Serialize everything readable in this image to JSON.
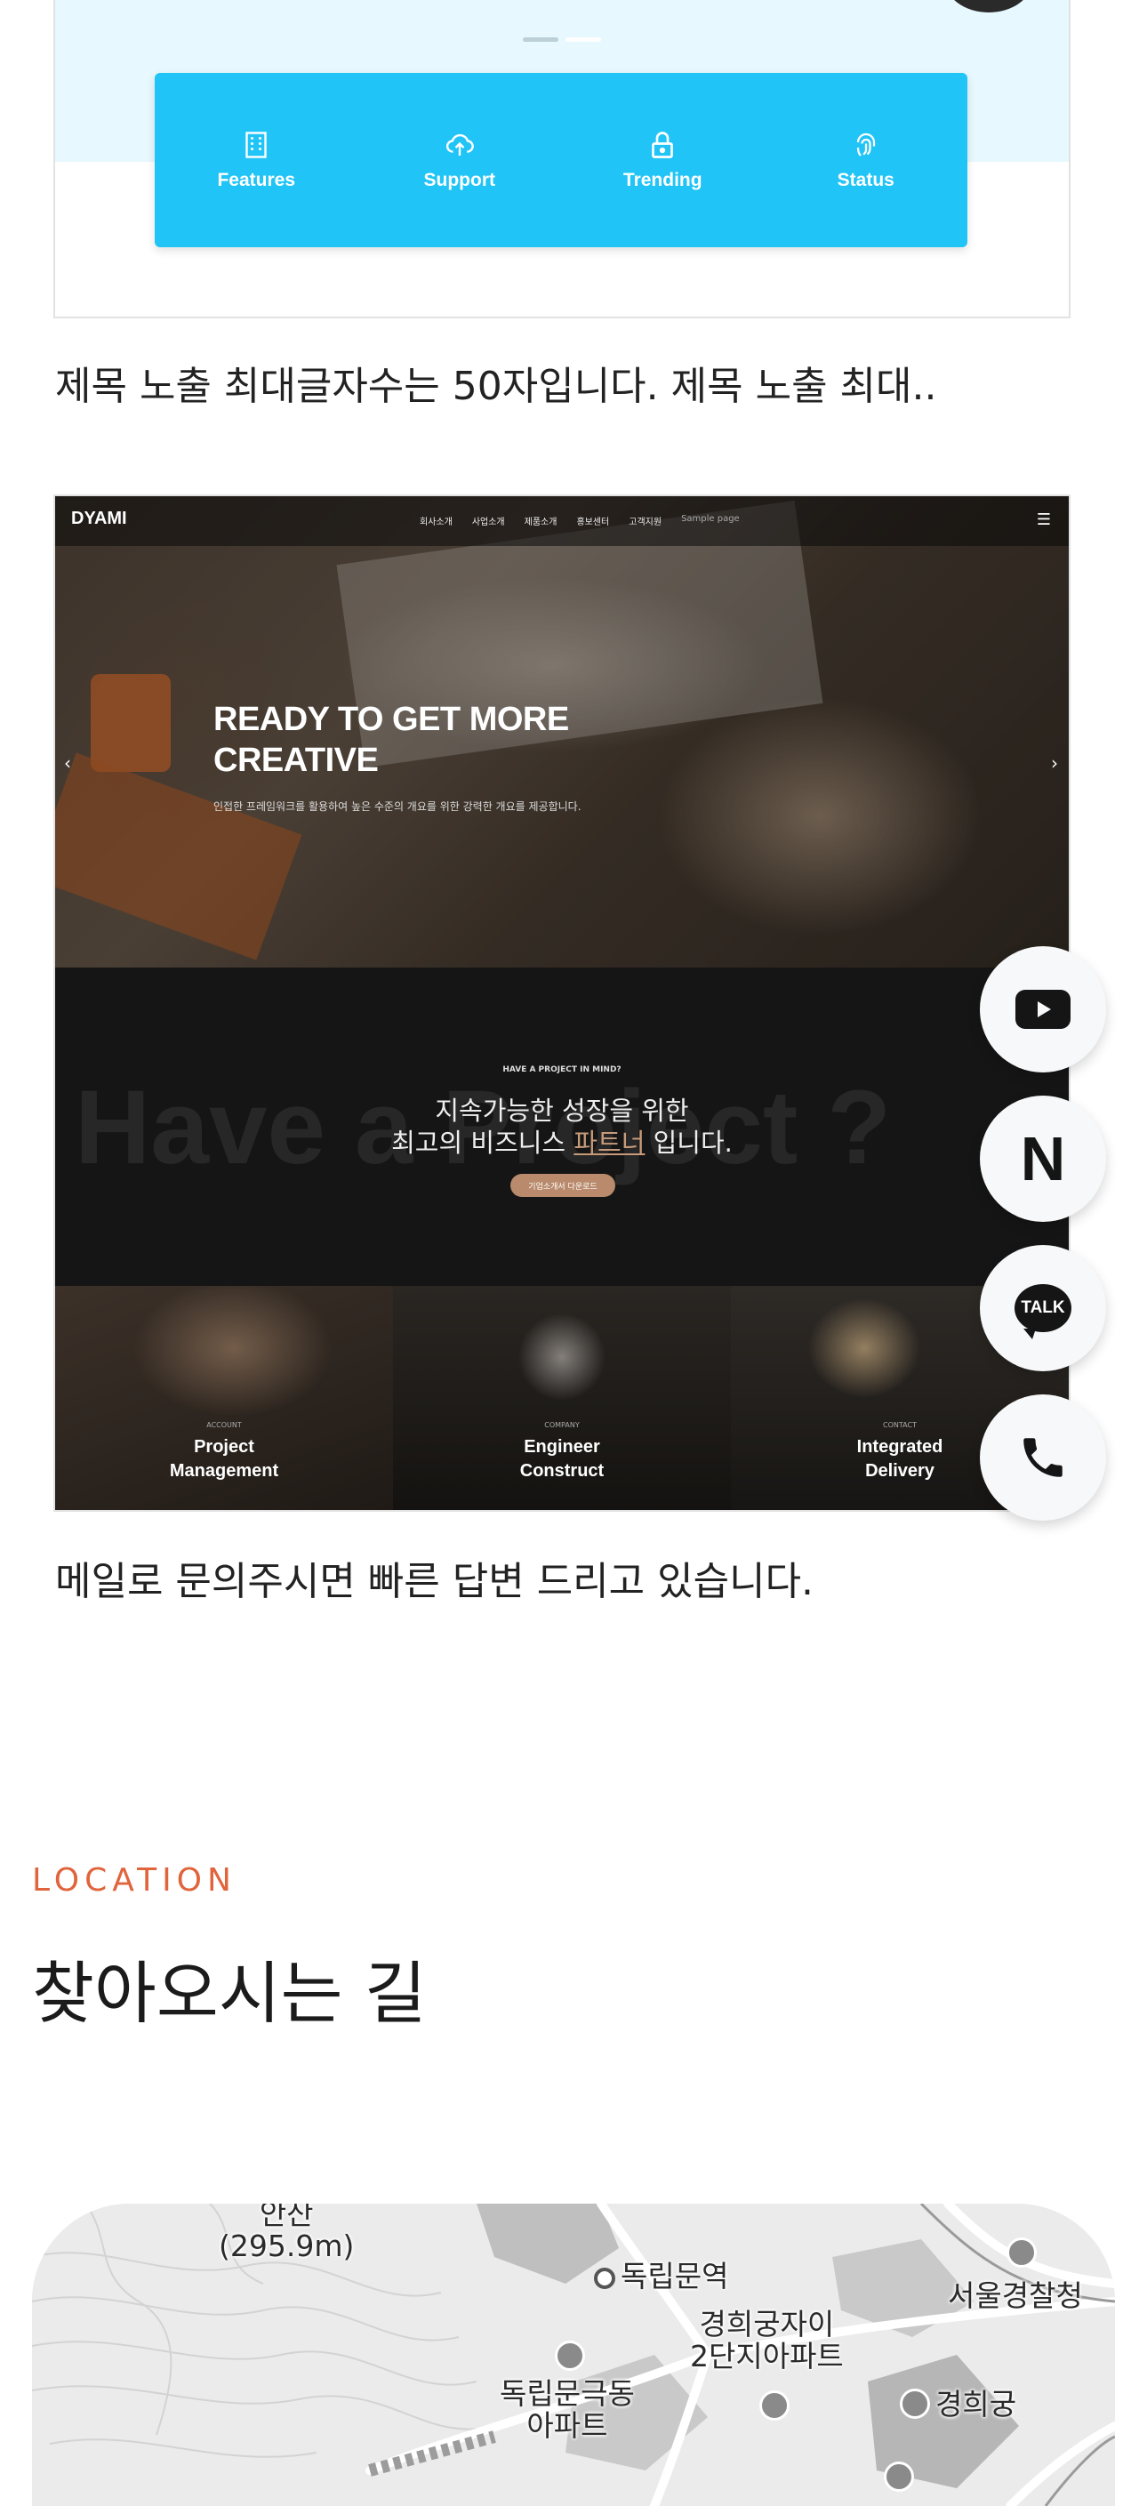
{
  "portfolio_item_1": {
    "feature_bar": {
      "items": [
        {
          "label": "Features",
          "icon": "building-icon"
        },
        {
          "label": "Support",
          "icon": "cloud-upload-icon"
        },
        {
          "label": "Trending",
          "icon": "lock-icon"
        },
        {
          "label": "Status",
          "icon": "fingerprint-icon"
        }
      ],
      "color": "#20c4f6"
    },
    "caption": "제목 노출 최대글자수는 50자입니다. 제목 노출 최대.."
  },
  "portfolio_item_2": {
    "preview": {
      "logo": "DYAMI",
      "menu": [
        "회사소개",
        "사업소개",
        "제품소개",
        "홍보센터",
        "고객지원",
        "Sample page"
      ],
      "hero_title_line1": "READY TO GET MORE",
      "hero_title_line2": "CREATIVE",
      "hero_sub": "인접한 프레임워크를 활용하여 높은 수준의 개요를 위한 강력한 개요를 제공합니다.",
      "mid_eyebrow": "HAVE A PROJECT IN MIND?",
      "mid_bg_text": "Have a Project ?",
      "mid_line1": "지속가능한 성장을 위한",
      "mid_line2_pre": "최고의 비즈니스 ",
      "mid_line2_hl": "파트너",
      "mid_line2_post": " 입니다.",
      "mid_button": "기업소개서 다운로드",
      "tiles": [
        {
          "small": "ACCOUNT",
          "title1": "Project",
          "title2": "Management"
        },
        {
          "small": "COMPANY",
          "title1": "Engineer",
          "title2": "Construct"
        },
        {
          "small": "CONTACT",
          "title1": "Integrated",
          "title2": "Delivery"
        }
      ]
    },
    "caption": "메일로 문의주시면 빠른 답변 드리고 있습니다."
  },
  "quick_buttons": [
    {
      "name": "youtube",
      "icon": "youtube-icon"
    },
    {
      "name": "naver",
      "label": "N",
      "icon": "naver-icon"
    },
    {
      "name": "kakaotalk",
      "label": "TALK",
      "icon": "kakaotalk-icon"
    },
    {
      "name": "phone",
      "icon": "phone-icon"
    }
  ],
  "location": {
    "eyebrow": "LOCATION",
    "title": "찾아오시는 길",
    "accent": "#e0643c",
    "map": {
      "labels": {
        "mountain": "안산",
        "mountain_height": "(295.9m)",
        "station": "독립문역",
        "apt1_line1": "경희궁자이",
        "apt1_line2": "2단지아파트",
        "police": "서울경찰청",
        "apt2_line1": "독립문극동",
        "apt2_line2": "아파트",
        "palace": "경희궁"
      }
    }
  }
}
